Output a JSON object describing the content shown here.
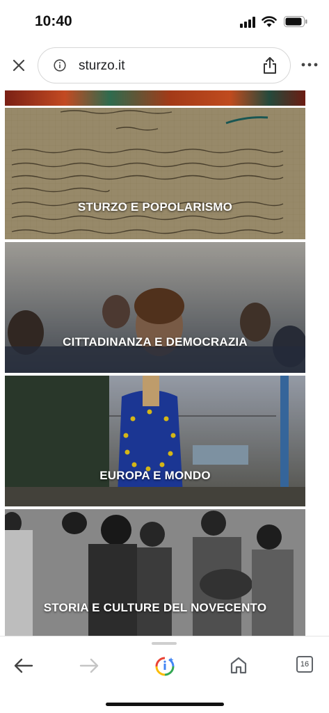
{
  "status_bar": {
    "time": "10:40"
  },
  "browser": {
    "url": "sturzo.it",
    "tab_count": "16",
    "icons": [
      "close-icon",
      "info-icon",
      "share-icon",
      "more-icon",
      "back-icon",
      "forward-icon",
      "google-lens-icon",
      "home-icon",
      "tabs-icon"
    ]
  },
  "sections": [
    {
      "label": "STURZO E POPOLARISMO"
    },
    {
      "label": "CITTADINANZA E DEMOCRAZIA"
    },
    {
      "label": "EUROPA E MONDO"
    },
    {
      "label": "STORIA E CULTURE DEL NOVECENTO"
    }
  ]
}
